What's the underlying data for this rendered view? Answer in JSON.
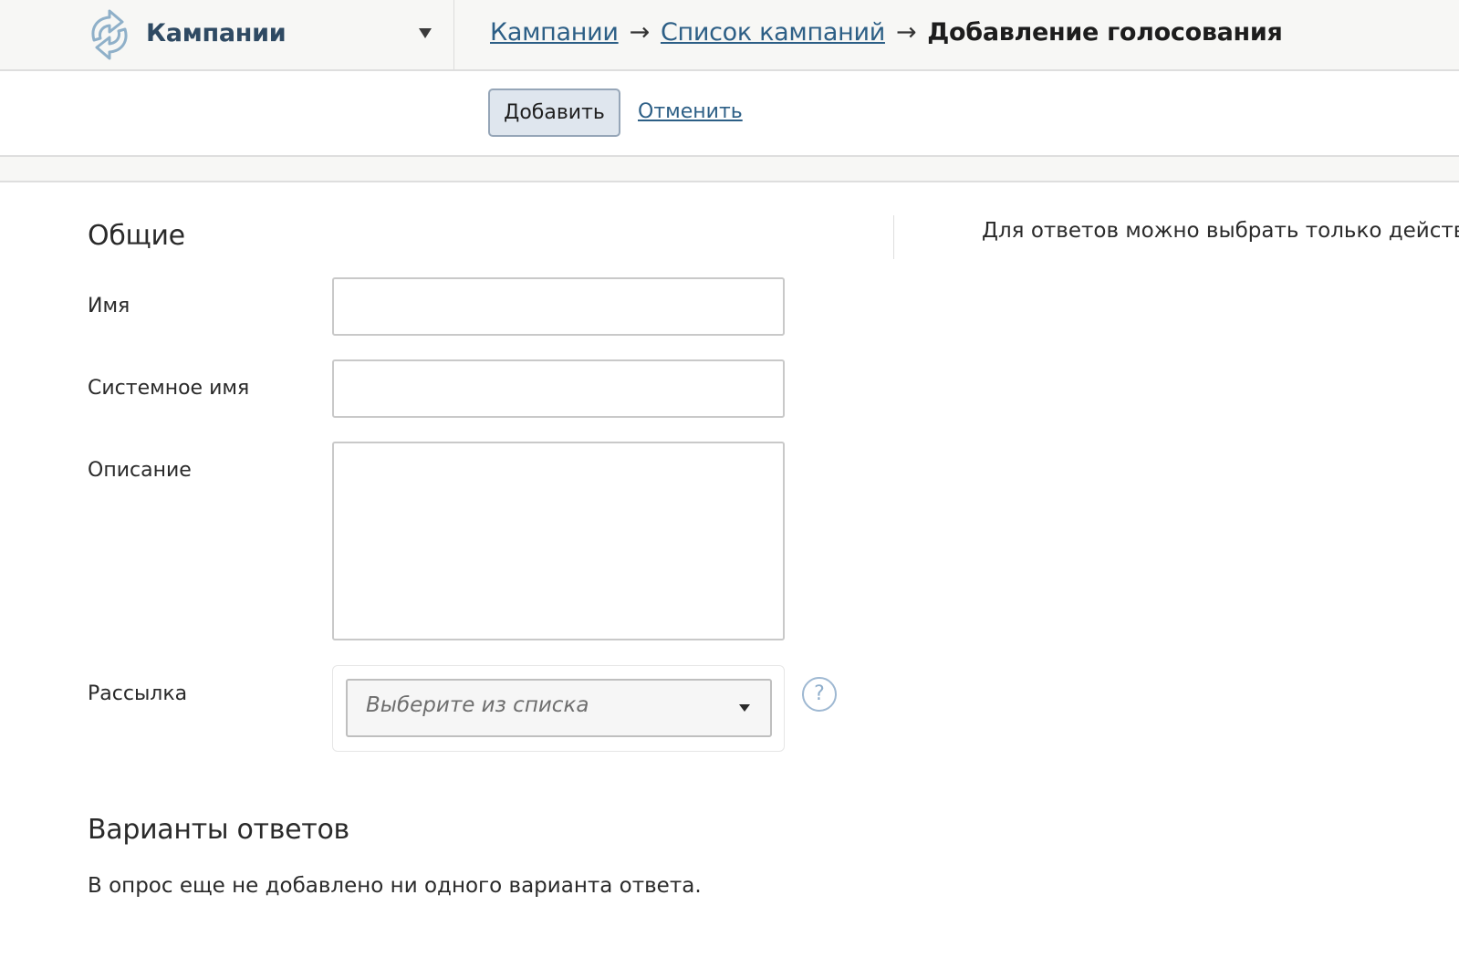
{
  "header": {
    "module_name": "Кампании",
    "logo_icon": "circular-arrows-icon",
    "breadcrumb": {
      "items": [
        "Кампании",
        "Список кампаний"
      ],
      "separator": "→",
      "current": "Добавление голосования"
    }
  },
  "toolbar": {
    "add_label": "Добавить",
    "cancel_label": "Отменить"
  },
  "form": {
    "general_title": "Общие",
    "fields": {
      "name": {
        "label": "Имя",
        "value": ""
      },
      "system_name": {
        "label": "Системное имя",
        "value": ""
      },
      "description": {
        "label": "Описание",
        "value": ""
      },
      "mailing": {
        "label": "Рассылка",
        "placeholder": "Выберите из списка",
        "help_symbol": "?"
      }
    },
    "answers_title": "Варианты ответов",
    "answers_empty": "В опрос еще не добавлено ни одного варианта ответа."
  },
  "sidebar_note": "Для ответов можно выбрать только действ",
  "colors": {
    "link": "#2d5f86",
    "module_title": "#2f4a63",
    "button_bg": "#dfe6ee",
    "button_border": "#96a6b8",
    "help_icon": "#9eb8d2"
  }
}
